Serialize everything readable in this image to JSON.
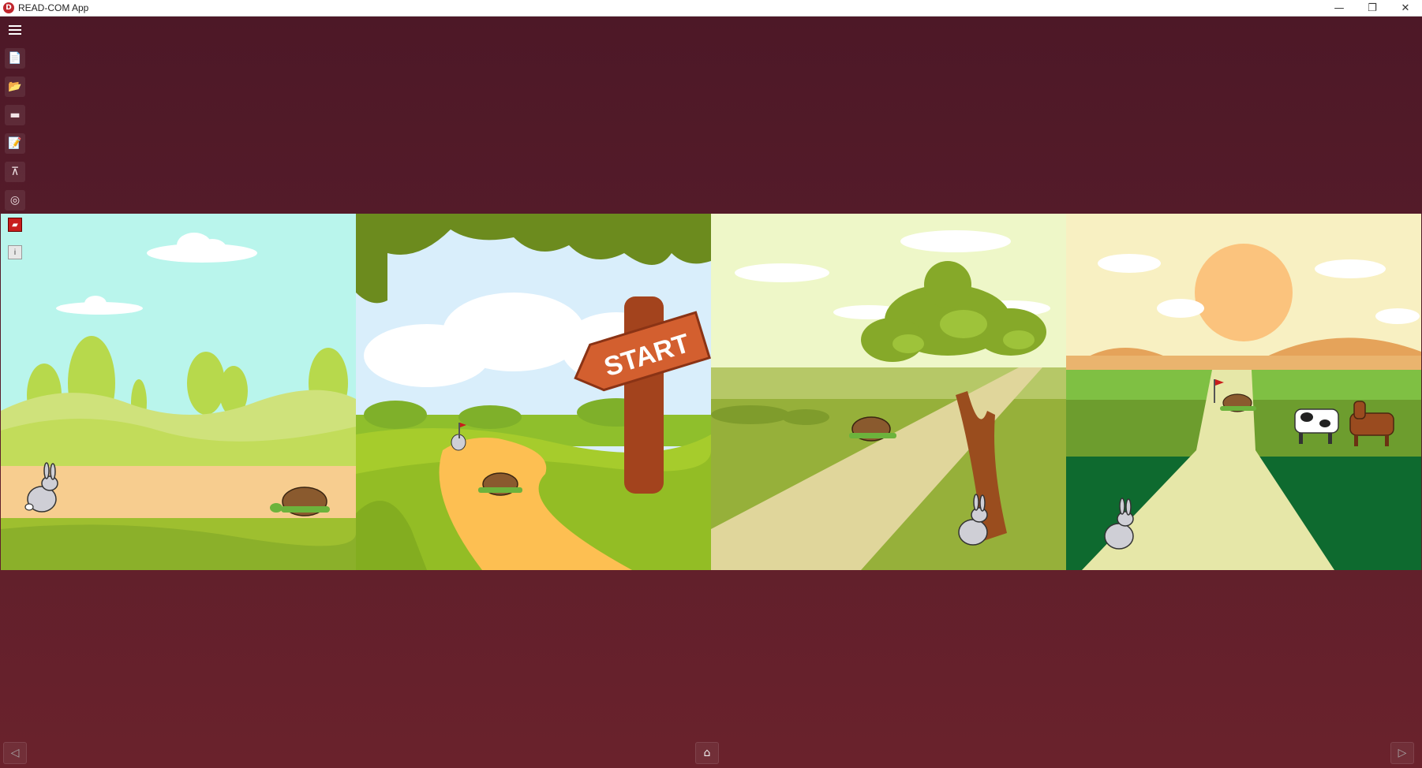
{
  "window": {
    "title": "READ-COM App",
    "logo_letter": "D",
    "controls": {
      "minimize": "—",
      "restore": "❐",
      "close": "✕"
    }
  },
  "sidebar": {
    "menu_icon": "hamburger-menu-icon",
    "items": [
      {
        "name": "new-document",
        "icon": "📄"
      },
      {
        "name": "open-folder",
        "icon": "📂"
      },
      {
        "name": "eraser",
        "icon": "▬"
      },
      {
        "name": "edit-notes",
        "icon": "📝"
      },
      {
        "name": "hierarchy",
        "icon": "⊼"
      },
      {
        "name": "settings",
        "icon": "◎"
      }
    ]
  },
  "panel1_overlay": {
    "flag_icon": "▰",
    "info_icon": "i"
  },
  "panels": [
    {
      "name": "panel-meadow",
      "description_icon": "hare-and-tortoise-meadow"
    },
    {
      "name": "panel-start",
      "sign_text": "START"
    },
    {
      "name": "panel-tree",
      "description_icon": "tortoise-ahead-tree"
    },
    {
      "name": "panel-finish",
      "description_icon": "tortoise-finish-sunset"
    }
  ],
  "nav": {
    "prev": "◁",
    "home": "⌂",
    "next": "▷"
  },
  "colors": {
    "background_top": "#4d1827",
    "background_bottom": "#6a222c",
    "sign_wood": "#d35f2f"
  }
}
